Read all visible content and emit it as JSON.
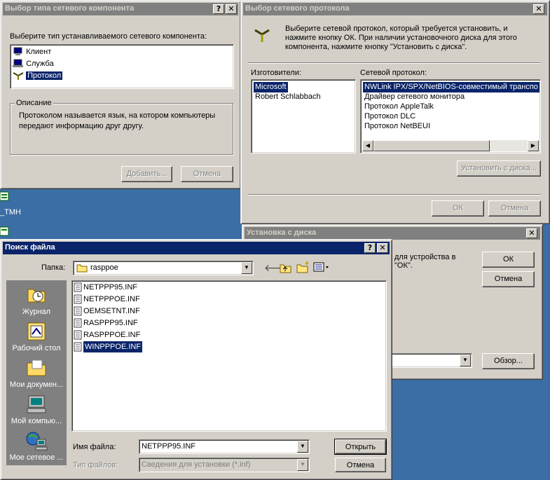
{
  "win1": {
    "title": "Выбор типа сетевого компонента",
    "prompt": "Выберите тип устанавливаемого сетевого компонента:",
    "items": [
      "Клиент",
      "Служба",
      "Протокол"
    ],
    "group_label": "Описание",
    "description": "Протоколом называется язык, на котором компьютеры передают информацию друг другу.",
    "add_label": "Добавить...",
    "cancel_label": "Отмена"
  },
  "win2": {
    "title": "Выбор сетевого протокола",
    "instructions": "Выберите сетевой протокол, который требуется установить, и нажмите кнопку ОК. При наличии установочного диска для этого компонента, нажмите кнопку \"Установить с диска\".",
    "manufacturers_label": "Изготовители:",
    "manufacturers": [
      "Microsoft",
      "Robert Schlabbach"
    ],
    "protocol_label": "Сетевой протокол:",
    "protocols": [
      "NWLink IPX/SPX/NetBIOS-совместимый транспо",
      "Драйвер сетевого монитора",
      "Протокол AppleTalk",
      "Протокол DLC",
      "Протокол NetBEUI"
    ],
    "disk_label": "Установить с диска...",
    "ok_label": "ОК",
    "cancel_label": "Отмена"
  },
  "win3": {
    "title": "Установка с диска",
    "text_line1": "для устройства в",
    "text_line2": "\"ОК\".",
    "ok_label": "ОК",
    "cancel_label": "Отмена",
    "browse_label": "Обзор..."
  },
  "desktop": {
    "label1": "_ТМН"
  },
  "win4": {
    "title": "Поиск файла",
    "folder_label": "Папка:",
    "folder_value": "rasppoe",
    "places": [
      "Журнал",
      "Рабочий стол",
      "Мои докумен...",
      "Мой компью...",
      "Мое сетевое ..."
    ],
    "files": [
      "NETPPP95.INF",
      "NETPPPOE.INF",
      "OEMSETNT.INF",
      "RASPPP95.INF",
      "RASPPPOE.INF",
      "WINPPPOE.INF"
    ],
    "filename_label": "Имя файла:",
    "filename_value": "NETPPP95.INF",
    "filetype_label": "Тип файлов:",
    "filetype_value": "Сведения для установки (*.inf)",
    "open_label": "Открыть",
    "cancel_label": "Отмена"
  }
}
